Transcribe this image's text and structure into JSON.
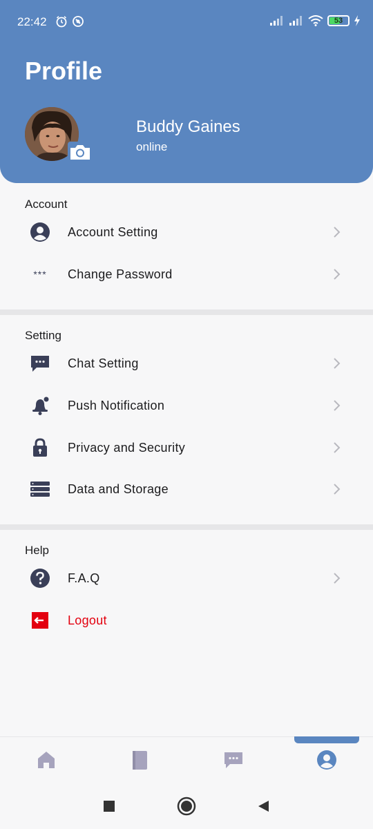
{
  "status_bar": {
    "time": "22:42",
    "battery": "53"
  },
  "header": {
    "title": "Profile",
    "user_name": "Buddy Gaines",
    "user_status": "online"
  },
  "sections": {
    "account": {
      "title": "Account",
      "items": [
        {
          "label": "Account Setting",
          "icon": "user-circle-icon"
        },
        {
          "label": "Change Password",
          "icon": "asterisks-icon"
        }
      ]
    },
    "setting": {
      "title": "Setting",
      "items": [
        {
          "label": "Chat Setting",
          "icon": "chat-bubble-icon"
        },
        {
          "label": "Push Notification",
          "icon": "bell-icon"
        },
        {
          "label": "Privacy and Security",
          "icon": "lock-icon"
        },
        {
          "label": "Data and Storage",
          "icon": "storage-icon"
        }
      ]
    },
    "help": {
      "title": "Help",
      "items": [
        {
          "label": "F.A.Q",
          "icon": "question-icon"
        },
        {
          "label": "Logout",
          "icon": "logout-icon"
        }
      ]
    }
  },
  "password_mask": "***",
  "colors": {
    "header_bg": "#5a86c0",
    "icon_dark": "#3a3f58",
    "logout_red": "#e3000f",
    "nav_inactive": "#a6a3bd"
  },
  "bottom_nav": [
    {
      "name": "home-icon",
      "active": false
    },
    {
      "name": "book-icon",
      "active": false
    },
    {
      "name": "chat-icon",
      "active": false
    },
    {
      "name": "profile-icon",
      "active": true
    }
  ]
}
